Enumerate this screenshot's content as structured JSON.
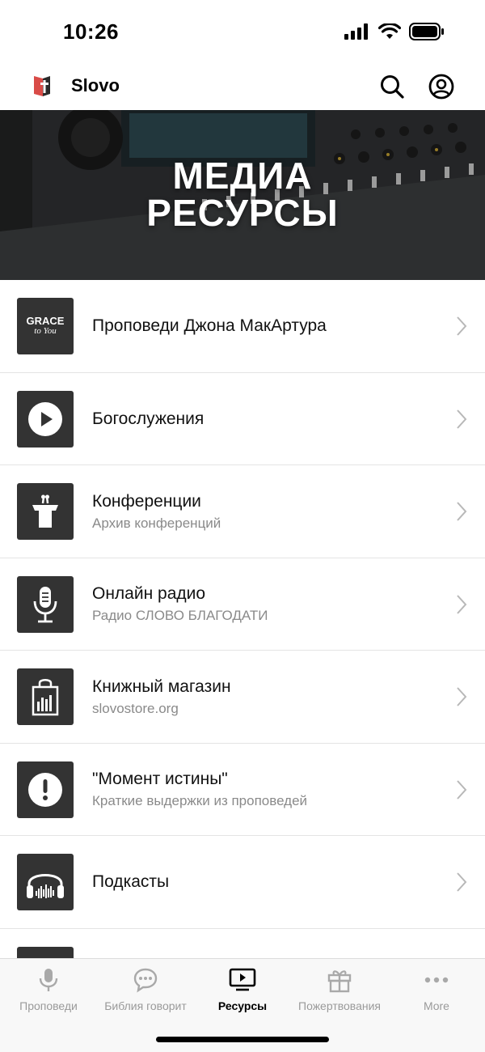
{
  "status_bar": {
    "time": "10:26"
  },
  "header": {
    "app_name": "Slovo"
  },
  "banner": {
    "line1": "МЕДИА",
    "line2": "РЕСУРСЫ"
  },
  "grace_logo": {
    "line1": "GRACE",
    "line2": "to You"
  },
  "list": [
    {
      "title": "Проповеди Джона МакАртура",
      "subtitle": "",
      "icon": "grace-to-you-logo-icon"
    },
    {
      "title": "Богослужения",
      "subtitle": "",
      "icon": "play-icon"
    },
    {
      "title": "Конференции",
      "subtitle": "Архив конференций",
      "icon": "podium-icon"
    },
    {
      "title": "Онлайн радио",
      "subtitle": "Радио СЛОВО БЛАГОДАТИ",
      "icon": "microphone-icon"
    },
    {
      "title": "Книжный магазин",
      "subtitle": "slovostore.org",
      "icon": "shopping-bag-icon"
    },
    {
      "title": "\"Момент истины\"",
      "subtitle": "Краткие выдержки из проповедей",
      "icon": "exclamation-icon"
    },
    {
      "title": "Подкасты",
      "subtitle": "",
      "icon": "headphones-icon"
    }
  ],
  "tabs": [
    {
      "label": "Проповеди",
      "icon": "microphone-icon",
      "active": false
    },
    {
      "label": "Библия говорит",
      "icon": "chat-bubble-icon",
      "active": false
    },
    {
      "label": "Ресурсы",
      "icon": "tv-play-icon",
      "active": true
    },
    {
      "label": "Пожертвования",
      "icon": "gift-icon",
      "active": false
    },
    {
      "label": "More",
      "icon": "more-dots-icon",
      "active": false
    }
  ],
  "colors": {
    "accent": "#000000",
    "inactive": "#9a9a9a",
    "tile": "#333333",
    "logo_red": "#d94b47"
  }
}
